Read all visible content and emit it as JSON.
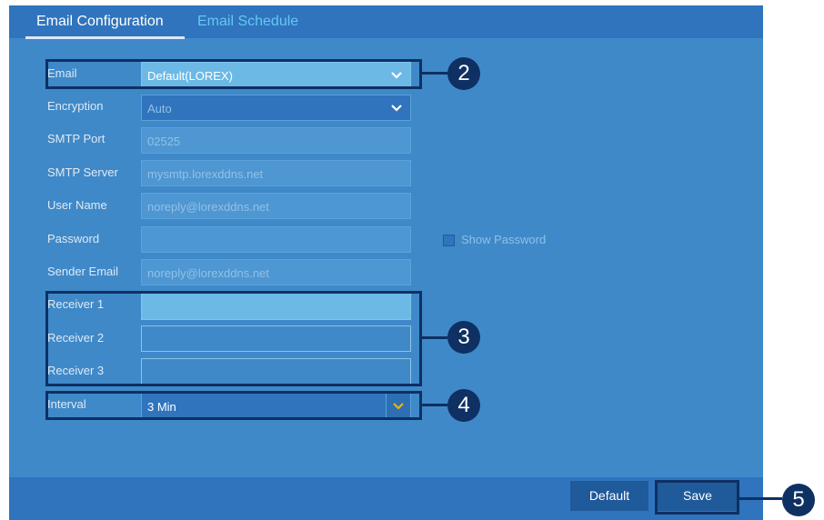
{
  "tabs": [
    {
      "label": "Email Configuration",
      "active": true
    },
    {
      "label": "Email Schedule",
      "active": false
    }
  ],
  "form": {
    "email": {
      "label": "Email",
      "value": "Default(LOREX)"
    },
    "encryption": {
      "label": "Encryption",
      "value": "Auto"
    },
    "smtp_port": {
      "label": "SMTP Port",
      "value": "02525"
    },
    "smtp_server": {
      "label": "SMTP Server",
      "value": "mysmtp.lorexddns.net"
    },
    "user_name": {
      "label": "User Name",
      "value": "noreply@lorexddns.net"
    },
    "password": {
      "label": "Password",
      "value": ""
    },
    "show_password": {
      "label": "Show Password",
      "checked": false
    },
    "sender_email": {
      "label": "Sender Email",
      "value": "noreply@lorexddns.net"
    },
    "receivers": [
      {
        "label": "Receiver 1",
        "value": ""
      },
      {
        "label": "Receiver 2",
        "value": ""
      },
      {
        "label": "Receiver 3",
        "value": ""
      }
    ],
    "interval": {
      "label": "Interval",
      "value": "3 Min"
    }
  },
  "buttons": {
    "default_label": "Default",
    "save_label": "Save"
  },
  "callouts": {
    "email": "2",
    "receivers": "3",
    "interval": "4",
    "save": "5"
  },
  "colors": {
    "panel": "#3f89c9",
    "header": "#2f74bd",
    "callout": "#0e3063",
    "highlight": "#6cb9e6",
    "accent_chevron": "#e7b51a"
  }
}
